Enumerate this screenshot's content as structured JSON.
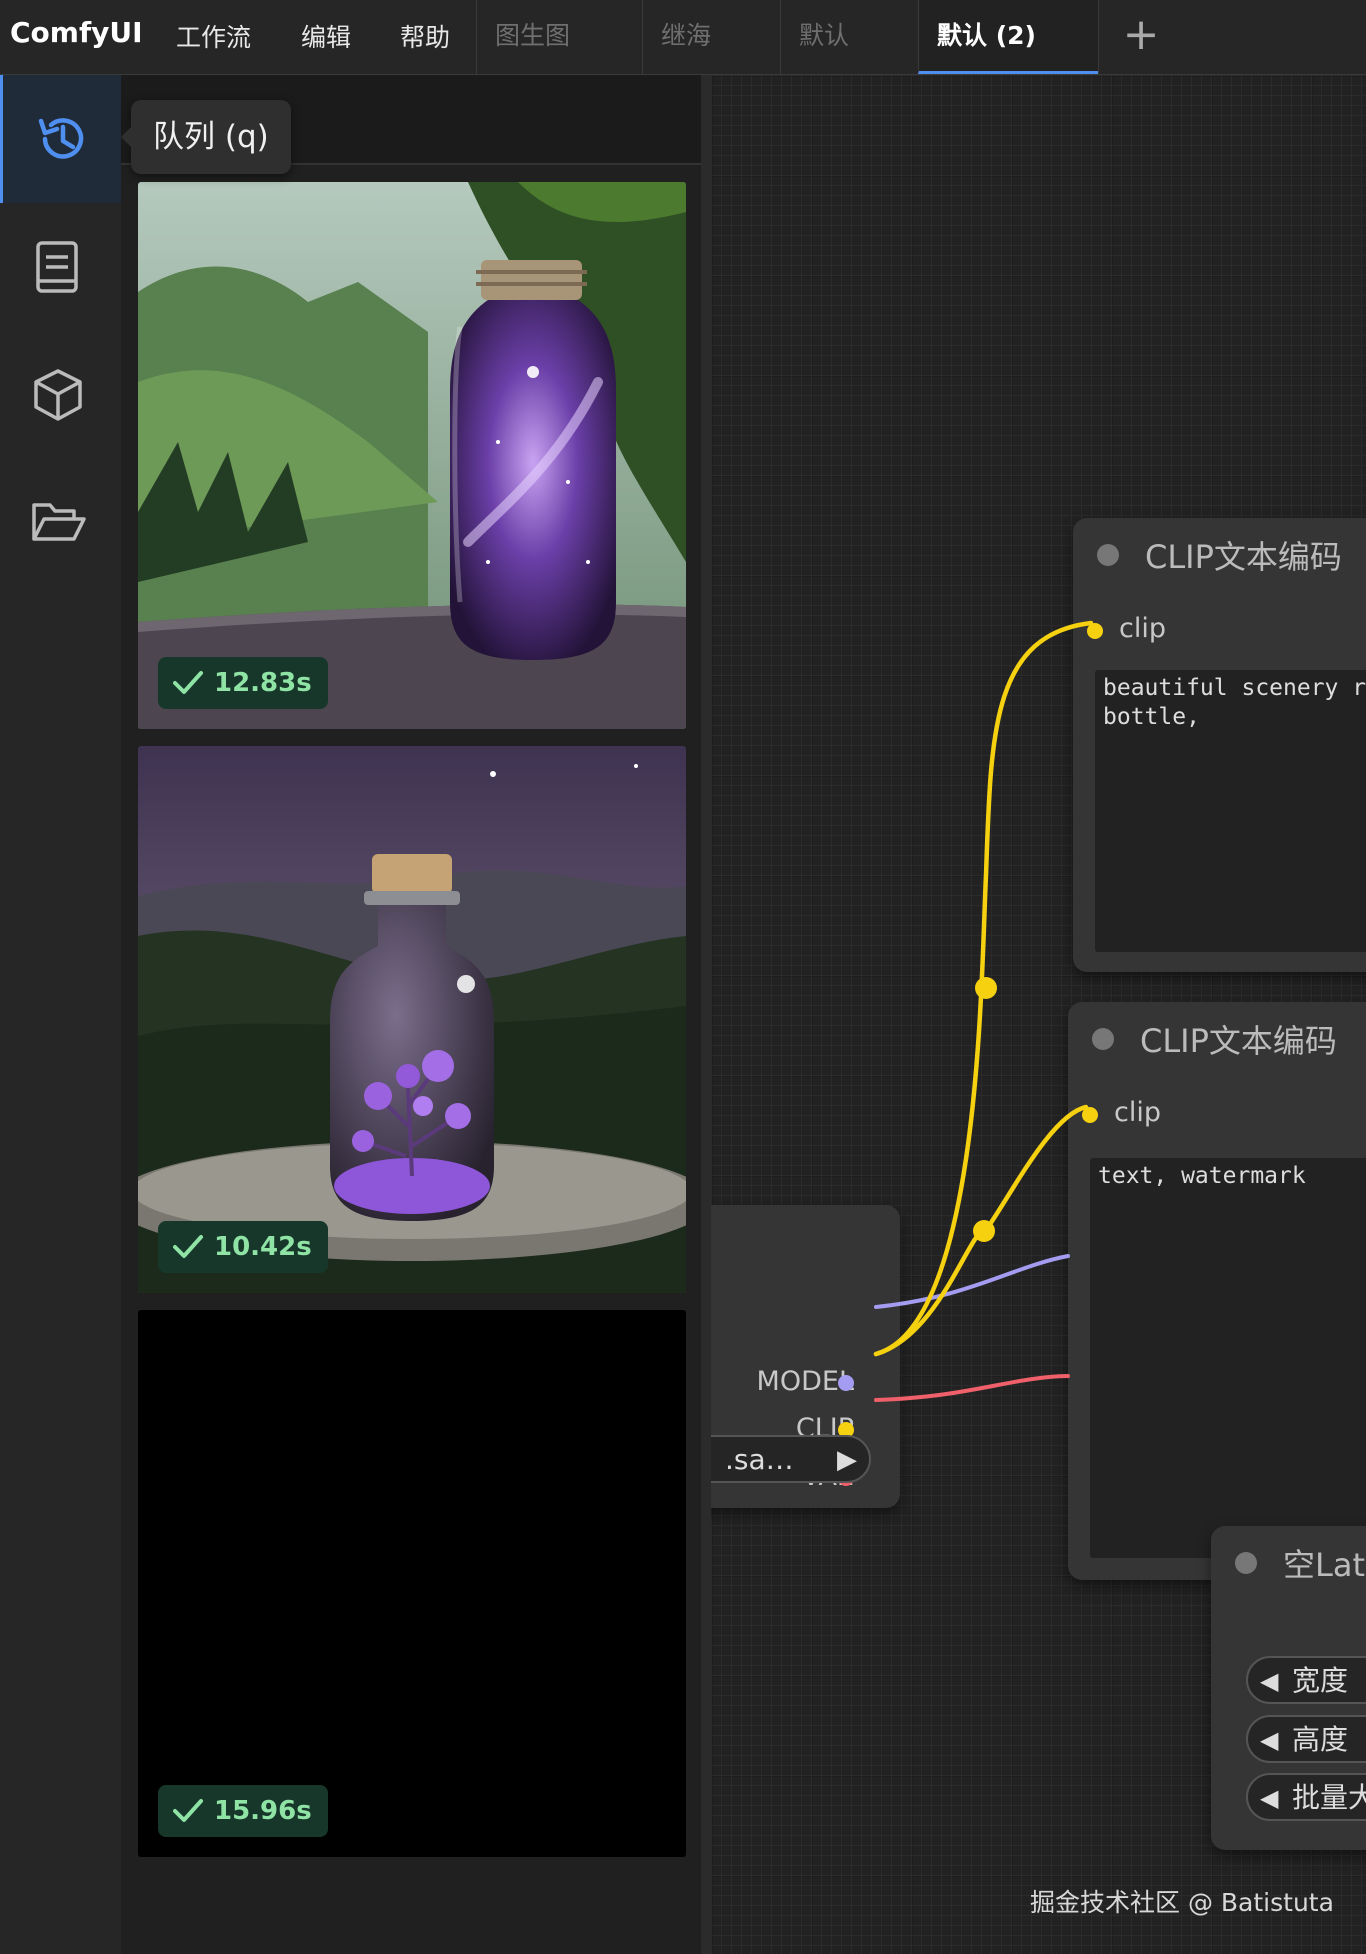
{
  "app": {
    "name": "ComfyUI"
  },
  "menu": [
    "工作流",
    "编辑",
    "帮助"
  ],
  "workflow_tabs": [
    {
      "label": "图生图",
      "active": false
    },
    {
      "label": "继海",
      "active": false
    },
    {
      "label": "默认",
      "active": false
    },
    {
      "label": "默认 (2)",
      "active": true
    }
  ],
  "sidebar": {
    "items": [
      {
        "icon": "history-icon",
        "active": true
      },
      {
        "icon": "book-icon",
        "active": false
      },
      {
        "icon": "cube-icon",
        "active": false
      },
      {
        "icon": "folder-open-icon",
        "active": false
      }
    ],
    "tooltip": "队列 (q)"
  },
  "queue": {
    "items": [
      {
        "time": "12.83s",
        "status": "done"
      },
      {
        "time": "10.42s",
        "status": "done"
      },
      {
        "time": "15.96s",
        "status": "done"
      }
    ]
  },
  "nodes": {
    "checkpoint": {
      "outputs": [
        {
          "label": "MODEL",
          "color": "#a49cf0"
        },
        {
          "label": "CLIP",
          "color": "#f5d10f"
        },
        {
          "label": "VAE",
          "color": "#f0606a"
        }
      ],
      "ckpt_value": ".sa…"
    },
    "clip_positive": {
      "title": "CLIP文本编码",
      "input": "clip",
      "text": "beautiful scenery r\nbottle,"
    },
    "clip_negative": {
      "title": "CLIP文本编码",
      "input": "clip",
      "text": "text, watermark"
    },
    "empty_latent": {
      "title": "空Late",
      "widgets": [
        "宽度",
        "高度",
        "批量大"
      ]
    }
  },
  "colors": {
    "accent": "#4f8ff0",
    "success_text": "#8fe3a5",
    "clip_wire": "#f5d10f",
    "model_wire": "#a49cf0",
    "vae_wire": "#f0606a"
  },
  "watermark": "掘金技术社区 @ Batistuta"
}
